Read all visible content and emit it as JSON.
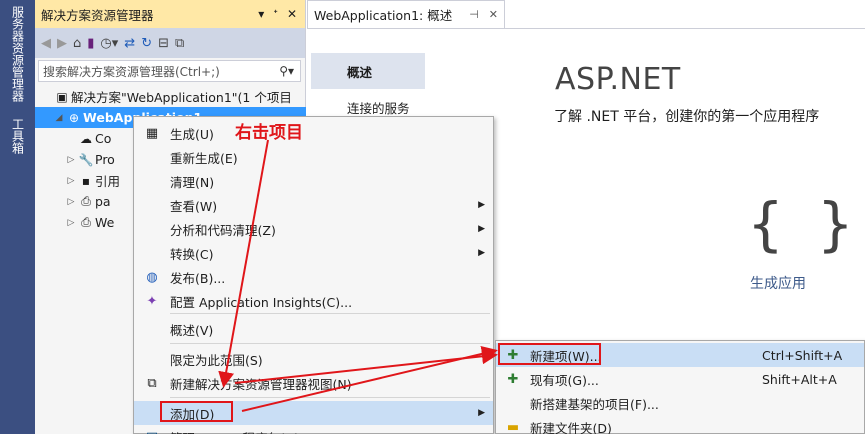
{
  "side_rail": {
    "items": [
      "服务器资源管理器",
      "工具箱"
    ]
  },
  "solution_explorer": {
    "title": "解决方案资源管理器",
    "title_controls": [
      "▾",
      "ᐩ",
      "✕"
    ],
    "toolbar_icons": [
      "back-icon",
      "forward-icon",
      "home-icon",
      "vs-icon",
      "history-icon",
      "sync-icon",
      "refresh-icon",
      "collapse-icon",
      "copy-icon"
    ],
    "search_placeholder": "搜索解决方案资源管理器(Ctrl+;)",
    "tree": [
      {
        "label": "解决方案\"WebApplication1\"(1 个项目",
        "indent": 0,
        "icon": "solution-icon",
        "expander": ""
      },
      {
        "label": "WebApplication1",
        "indent": 1,
        "icon": "web-project-icon",
        "expander": "◢",
        "selected": true
      },
      {
        "label": "Co",
        "indent": 2,
        "icon": "connected-services-icon",
        "expander": ""
      },
      {
        "label": "Pro",
        "indent": 2,
        "icon": "wrench-icon",
        "expander": "▷"
      },
      {
        "label": "引用",
        "indent": 2,
        "icon": "references-icon",
        "expander": "▷"
      },
      {
        "label": "pa",
        "indent": 2,
        "icon": "config-file-icon",
        "expander": "▷"
      },
      {
        "label": "We",
        "indent": 2,
        "icon": "config-file-icon",
        "expander": "▷"
      }
    ]
  },
  "document_tab": {
    "title": "WebApplication1: 概述",
    "pin": "⊣",
    "close": "✕"
  },
  "overview": {
    "nav": [
      "概述",
      "连接的服务"
    ],
    "heading": "ASP.NET",
    "subheading": "了解 .NET 平台，创建你的第一个应用程序",
    "brace": "{ }",
    "build_link": "生成应用"
  },
  "context_menu": {
    "items": [
      {
        "label": "生成(U)",
        "icon": "build-icon"
      },
      {
        "label": "重新生成(E)",
        "icon": ""
      },
      {
        "label": "清理(N)",
        "icon": ""
      },
      {
        "label": "查看(W)",
        "icon": "",
        "submenu": true
      },
      {
        "label": "分析和代码清理(Z)",
        "icon": "",
        "submenu": true
      },
      {
        "label": "转换(C)",
        "icon": "",
        "submenu": true
      },
      {
        "label": "发布(B)...",
        "icon": "globe-icon"
      },
      {
        "label": "配置 Application Insights(C)...",
        "icon": "insights-icon"
      },
      {
        "label": "概述(V)",
        "icon": ""
      },
      {
        "label": "限定为此范围(S)",
        "icon": ""
      },
      {
        "label": "新建解决方案资源管理器视图(N)",
        "icon": "new-view-icon"
      },
      {
        "label": "添加(D)",
        "icon": "",
        "submenu": true,
        "highlighted": true
      },
      {
        "label": "管理 NuGet 程序包(N)...",
        "icon": "nuget-icon"
      }
    ]
  },
  "add_submenu": {
    "items": [
      {
        "label": "新建项(W)...",
        "shortcut": "Ctrl+Shift+A",
        "icon": "new-item-icon",
        "highlighted": true
      },
      {
        "label": "现有项(G)...",
        "shortcut": "Shift+Alt+A",
        "icon": "existing-item-icon"
      },
      {
        "label": "新搭建基架的项目(F)...",
        "shortcut": "",
        "icon": ""
      },
      {
        "label": "新建文件夹(D)",
        "shortcut": "",
        "icon": "folder-icon"
      }
    ]
  },
  "annotation": {
    "text": "右击项目",
    "color": "#e0161a"
  }
}
